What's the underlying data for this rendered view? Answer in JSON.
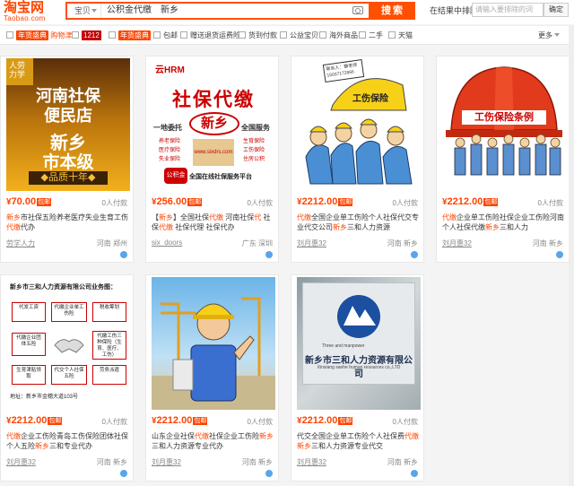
{
  "header": {
    "logo_cn": "淘宝网",
    "logo_en": "Taobao.com",
    "search_category": "宝贝",
    "search_query": "公积金代缴　新乡",
    "search_button": "搜索",
    "within_results_label": "在结果中排除",
    "within_results_placeholder": "请输入要排除的词",
    "within_results_button": "确定"
  },
  "filters": [
    {
      "label": "购物津贴",
      "badge": "年货盛典",
      "badge_color": "#ff4400"
    },
    {
      "label": "",
      "badge": "1212",
      "badge_color": "#c40000"
    },
    {
      "label": "",
      "badge": "年货盛典",
      "badge_color": "#ff4400"
    },
    {
      "label": "包邮"
    },
    {
      "label": "赠送退货运费险"
    },
    {
      "label": "货到付款"
    },
    {
      "label": "公益宝贝"
    },
    {
      "label": "海外商品"
    },
    {
      "label": "二手"
    },
    {
      "label": "天猫"
    }
  ],
  "more_label": "更多",
  "cards": [
    {
      "price": "70.00",
      "tag": "包邮",
      "paid": "0人付款",
      "title_parts": [
        [
          "",
          "新乡"
        ],
        [
          "n",
          "市社保五险养老医疗失业生育工伤"
        ],
        [
          "",
          "代缴"
        ],
        [
          "n",
          "代办"
        ]
      ],
      "shop": "劳学人力",
      "location": "河南 郑州"
    },
    {
      "price": "256.00",
      "tag": "包邮",
      "paid": "0人付款",
      "title_parts": [
        [
          "n",
          "【"
        ],
        [
          "",
          "新乡"
        ],
        [
          "n",
          "】全国社保"
        ],
        [
          "",
          "代缴"
        ],
        [
          "n",
          " 河南社保"
        ],
        [
          "",
          "代"
        ],
        [
          "n",
          " 社保"
        ],
        [
          "",
          "代缴"
        ],
        [
          "n",
          " 社保代理 社保代办"
        ]
      ],
      "shop": "six_doors",
      "location": "广东 深圳"
    },
    {
      "price": "2212.00",
      "tag": "包邮",
      "paid": "0人付款",
      "title_parts": [
        [
          "",
          "代缴"
        ],
        [
          "n",
          "全国企业单工伤险个人社保代交专业代交公司"
        ],
        [
          "",
          "新乡"
        ],
        [
          "n",
          "三和人力资源"
        ]
      ],
      "shop": "刘月惠32",
      "location": "河南 新乡"
    },
    {
      "price": "2212.00",
      "tag": "包邮",
      "paid": "0人付款",
      "title_parts": [
        [
          "",
          "代缴"
        ],
        [
          "n",
          "企业单工伤险社保企业工伤险河南个人社保代缴"
        ],
        [
          "",
          "新乡"
        ],
        [
          "n",
          "三和人力"
        ]
      ],
      "shop": "刘月惠32",
      "location": "河南 新乡"
    },
    {
      "price": "2212.00",
      "tag": "包邮",
      "paid": "0人付款",
      "title_parts": [
        [
          "",
          "代缴"
        ],
        [
          "n",
          "企业工伤险青岛工伤保险团体社保个人五险"
        ],
        [
          "",
          "新乡"
        ],
        [
          "n",
          "三和专业代办"
        ]
      ],
      "shop": "刘月惠32",
      "location": "河南 新乡"
    },
    {
      "price": "2212.00",
      "tag": "包邮",
      "paid": "0人付款",
      "title_parts": [
        [
          "n",
          "山东企业社保"
        ],
        [
          "",
          "代缴"
        ],
        [
          "n",
          "社保企业工伤险"
        ],
        [
          "",
          "新乡"
        ],
        [
          "n",
          "三和人力资源专业代办"
        ]
      ],
      "shop": "刘月惠32",
      "location": "河南 新乡"
    },
    {
      "price": "2212.00",
      "tag": "包邮",
      "paid": "0人付款",
      "title_parts": [
        [
          "n",
          "代交全国企业单工伤险个人社保费"
        ],
        [
          "",
          "代缴新乡"
        ],
        [
          "n",
          "三和人力资源专业代交"
        ]
      ],
      "shop": "刘月惠32",
      "location": "河南 新乡"
    }
  ],
  "img1": {
    "corner": "人劳力学",
    "line1": "河南社保",
    "line2": "便民店",
    "line3": "新乡",
    "line4": "市本级",
    "line5": "◆品质十年◆"
  },
  "img2": {
    "banner": "云HRM",
    "big": "社保代缴",
    "city": "新乡",
    "left_tag": "一地委托",
    "right_tag": "全国服务",
    "items_l": [
      "养老保险",
      "医疗保险",
      "失业保险"
    ],
    "items_r": [
      "生育保险",
      "工伤保险",
      "住房公积"
    ],
    "footer": "全国在线社保服务平台",
    "fund": "公积金",
    "site": "www.sixdrs.com"
  },
  "img3": {
    "banner": "工伤保险",
    "phone": "联系人：静老师 15037172866"
  },
  "img4": {
    "banner": "工伤保险条例"
  },
  "img5": {
    "title": "新乡市三和人力资源有限公司业务图：",
    "boxes": [
      "代发工资",
      "代缴企业单工伤险",
      "税收筹划",
      "代缴企业团体五险",
      "代缴工伤三种保险（生育、医疗、工伤）",
      "生育津贴领取",
      "代交个人社保五险",
      "劳务派遣"
    ],
    "address": "地址：新乡市金穗大道103号"
  },
  "img7": {
    "name": "新乡市三和人力资源有限公司",
    "small": "Three and manpower",
    "url": "Xinxiang sanhe human resources co.,LTD"
  }
}
